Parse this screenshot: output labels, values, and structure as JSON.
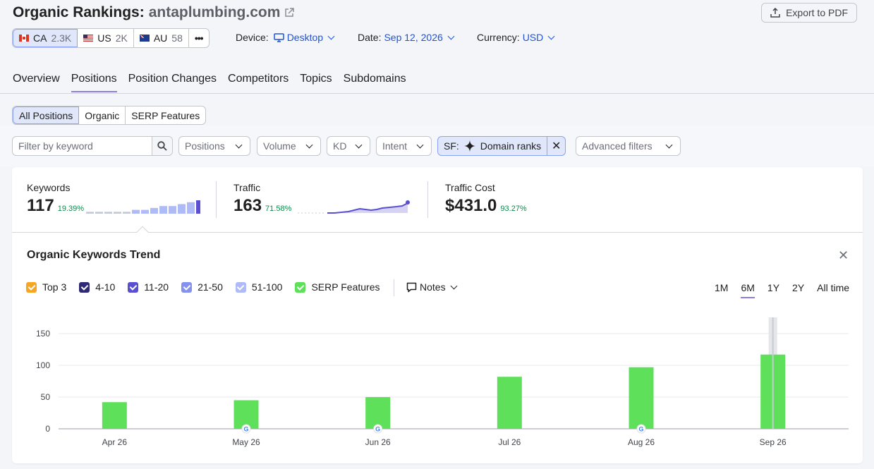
{
  "header": {
    "title": "Organic Rankings:",
    "domain": "antaplumbing.com",
    "export_label": "Export to PDF"
  },
  "databases": [
    {
      "code": "CA",
      "count": "2.3K",
      "active": true
    },
    {
      "code": "US",
      "count": "2K",
      "active": false
    },
    {
      "code": "AU",
      "count": "58",
      "active": false
    }
  ],
  "more_label": "•••",
  "device": {
    "label": "Device:",
    "value": "Desktop"
  },
  "date": {
    "label": "Date:",
    "value": "Sep 12, 2026"
  },
  "currency": {
    "label": "Currency:",
    "value": "USD"
  },
  "tabs": [
    "Overview",
    "Positions",
    "Position Changes",
    "Competitors",
    "Topics",
    "Subdomains"
  ],
  "active_tab": "Positions",
  "segments": [
    "All Positions",
    "Organic",
    "SERP Features"
  ],
  "filters": {
    "search_placeholder": "Filter by keyword",
    "positions": "Positions",
    "volume": "Volume",
    "kd": "KD",
    "intent": "Intent",
    "sf_prefix": "SF:",
    "sf_value": "Domain ranks",
    "advanced": "Advanced filters"
  },
  "summary": {
    "keywords": {
      "label": "Keywords",
      "value": "117",
      "change": "19.39%",
      "spark": [
        1,
        1,
        1,
        1,
        1,
        2,
        2,
        3,
        4,
        4,
        5,
        6,
        7
      ]
    },
    "traffic": {
      "label": "Traffic",
      "value": "163",
      "change": "71.58%"
    },
    "traffic_cost": {
      "label": "Traffic Cost",
      "value": "$431.0",
      "change": "93.27%"
    }
  },
  "trend": {
    "title": "Organic Keywords Trend",
    "notes_label": "Notes",
    "legend": [
      {
        "label": "Top 3",
        "color": "#f5a623"
      },
      {
        "label": "4-10",
        "color": "#2e2a73"
      },
      {
        "label": "11-20",
        "color": "#5a4fd1"
      },
      {
        "label": "21-50",
        "color": "#8491ef"
      },
      {
        "label": "51-100",
        "color": "#aebbf7"
      },
      {
        "label": "SERP Features",
        "color": "#5ee05a"
      }
    ],
    "ranges": [
      "1M",
      "6M",
      "1Y",
      "2Y",
      "All time"
    ],
    "active_range": "6M"
  },
  "chart_data": {
    "type": "bar",
    "categories": [
      "Apr 26",
      "May 26",
      "Jun 26",
      "Jul 26",
      "Aug 26",
      "Sep 26"
    ],
    "series": [
      {
        "name": "SERP Features",
        "values": [
          42,
          45,
          50,
          82,
          97,
          117
        ]
      }
    ],
    "google_markers": [
      false,
      true,
      true,
      false,
      true,
      false
    ],
    "ylim": [
      0,
      170
    ],
    "yticks": [
      0,
      50,
      100,
      150
    ],
    "grid": true,
    "bar_color": "#5ee05a"
  }
}
